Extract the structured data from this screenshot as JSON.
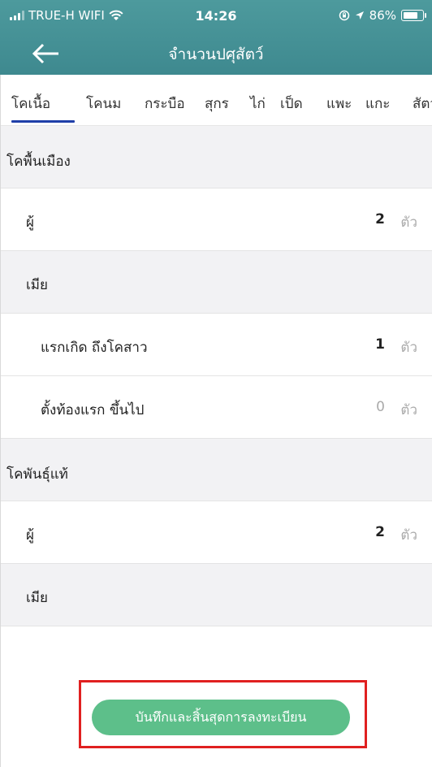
{
  "status_bar": {
    "carrier": "TRUE-H WIFI",
    "time": "14:26",
    "battery": "86%",
    "battery_level": 0.86,
    "icons": [
      "signal-icon",
      "wifi-icon",
      "orientation-lock-icon",
      "location-icon",
      "battery-icon"
    ]
  },
  "header": {
    "title": "จำนวนปศุสัตว์",
    "back_icon": "arrow-left-icon"
  },
  "tabs": [
    {
      "label": "โคเนื้อ",
      "active": true
    },
    {
      "label": "โคนม",
      "active": false
    },
    {
      "label": "กระบือ",
      "active": false
    },
    {
      "label": "สุกร",
      "active": false
    },
    {
      "label": "ไก่",
      "active": false
    },
    {
      "label": "เป็ด",
      "active": false
    },
    {
      "label": "แพะ",
      "active": false
    },
    {
      "label": "แกะ",
      "active": false
    },
    {
      "label": "สัตว์",
      "active": false
    }
  ],
  "list": {
    "unit": "ตัว",
    "rows": [
      {
        "label": "โคพื้นเมือง"
      },
      {
        "label": "ผู้",
        "value": "2"
      },
      {
        "label": "เมีย"
      },
      {
        "label": "แรกเกิด ถึงโคสาว",
        "value": "1"
      },
      {
        "label": "ตั้งท้องแรก ขึ้นไป",
        "value": "0"
      },
      {
        "label": "โคพันธุ์แท้"
      },
      {
        "label": "ผู้",
        "value": "2"
      },
      {
        "label": "เมีย"
      }
    ]
  },
  "footer": {
    "save_button": "บันทึกและสิ้นสุดการลงทะเบียน"
  },
  "colors": {
    "header_bg": "#3e898f",
    "tab_underline": "#1f3fa8",
    "button_bg": "#5dbf8a",
    "highlight_border": "#e02020"
  }
}
